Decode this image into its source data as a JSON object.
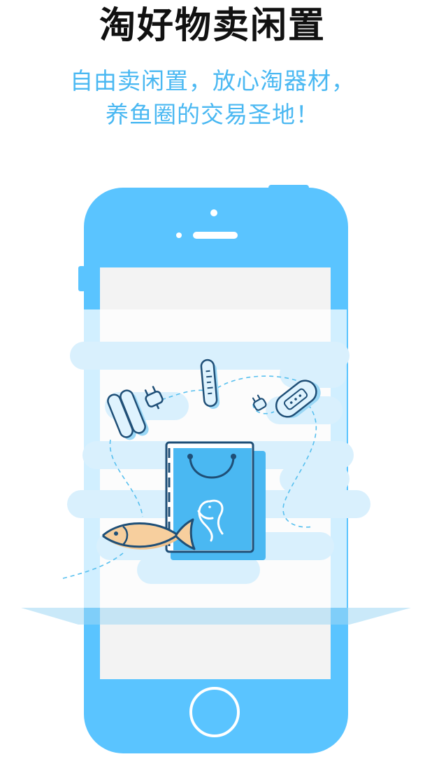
{
  "headline": "淘好物卖闲置",
  "tagline": {
    "line1": "自由卖闲置，放心淘器材，",
    "line2": "养鱼圈的交易圣地！"
  },
  "icons": {
    "phone": "smartphone-icon",
    "bag": "shopping-bag-icon",
    "fish": "fish-icon",
    "thermometer": "thermometer-icon",
    "tubes": "heater-tubes-icon",
    "plug": "power-plug-icon",
    "lamp": "aquarium-lamp-icon",
    "home": "home-button-icon"
  },
  "colors": {
    "phone_body": "#5ac4ff",
    "screen": "#f3f3f3",
    "cloud": "#d9f0fd",
    "headline": "#111111",
    "tagline": "#4ab8f2",
    "outline": "#1f4f77",
    "fish_body": "#f7cf9e"
  }
}
